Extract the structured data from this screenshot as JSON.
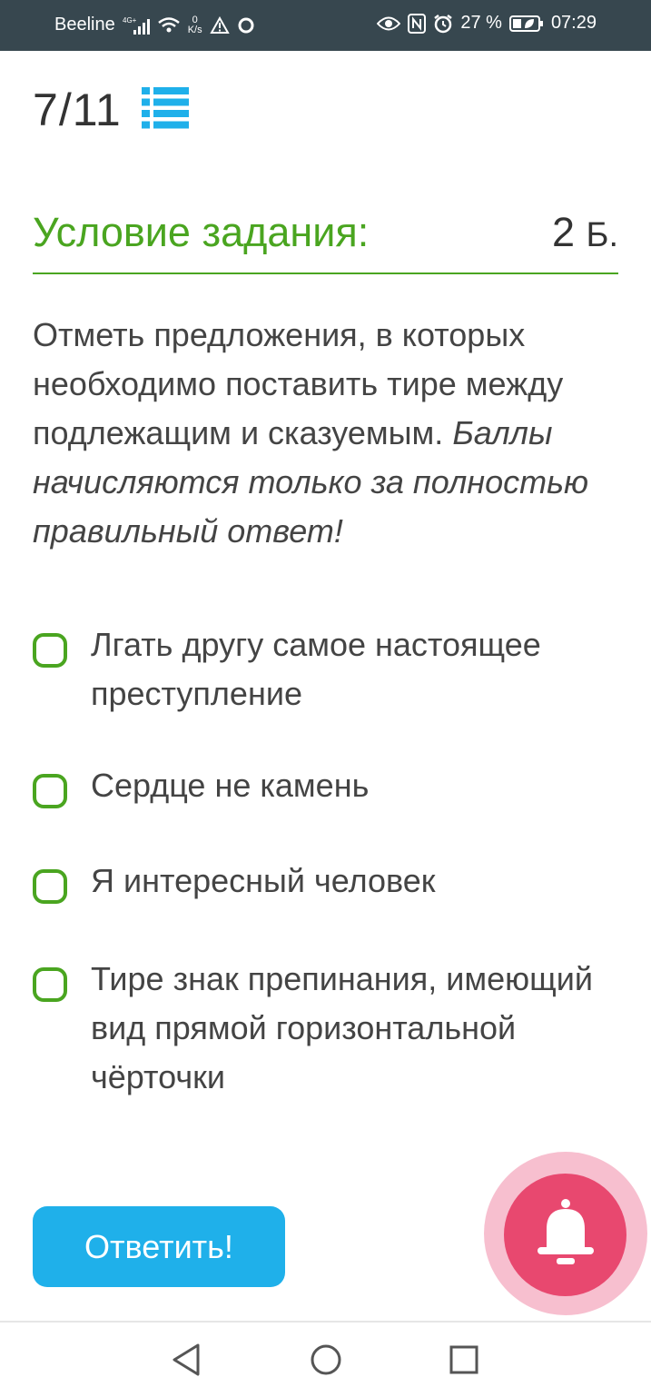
{
  "status_bar": {
    "carrier": "Beeline",
    "network_type": "4G+",
    "data_rate_value": "0",
    "data_rate_unit": "K/s",
    "battery": "27 %",
    "time": "07:29",
    "icons": [
      "signal-icon",
      "wifi-icon",
      "warning-icon",
      "chat-bubble-icon",
      "eye-icon",
      "nfc-icon",
      "alarm-icon",
      "battery-icon"
    ]
  },
  "progress": {
    "current": "7",
    "separator": "/",
    "total": "11",
    "list_icon": "list-icon"
  },
  "section": {
    "title": "Условие задания:",
    "points_value": "2",
    "points_unit": "Б."
  },
  "question": {
    "text": "Отметь предложения, в которых необходимо поставить тире между подлежащим и сказуемым.",
    "note": "Баллы начисляются только за полностью правильный ответ!"
  },
  "options": [
    {
      "label": "Лгать другу самое настоящее преступление",
      "checked": false
    },
    {
      "label": "Сердце не камень",
      "checked": false
    },
    {
      "label": "Я интересный человек",
      "checked": false
    },
    {
      "label": "Тире знак препинания, имеющий вид прямой горизонтальной чёрточки",
      "checked": false
    }
  ],
  "answer_button": {
    "label": "Ответить!"
  },
  "notification_button": {
    "icon": "bell-icon"
  },
  "navigation_bar": {
    "icons": [
      "back-icon",
      "home-icon",
      "recents-icon"
    ]
  },
  "colors": {
    "accent_green": "#4aa520",
    "button_blue": "#1fb0ea",
    "bell_pink": "#e8486f",
    "status_bar_bg": "#37474f",
    "text_dark": "#444444"
  }
}
